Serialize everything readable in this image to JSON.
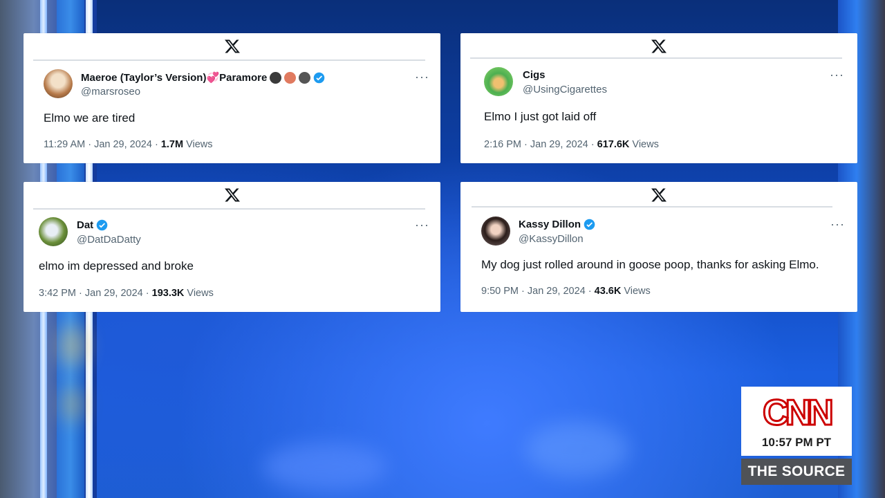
{
  "tweets": [
    {
      "display_name": "Maeroe (Taylor’s Version)💞Paramore",
      "handle": "@marsroseo",
      "text": "Elmo we are tired",
      "time": "11:29 AM · Jan 29, 2024 · ",
      "views_count": "1.7M",
      "views_label": " Views",
      "verified": true
    },
    {
      "display_name": "Cigs",
      "handle": "@UsingCigarettes",
      "text": "Elmo I just got laid off",
      "time": "2:16 PM · Jan 29, 2024 · ",
      "views_count": "617.6K",
      "views_label": " Views",
      "verified": false
    },
    {
      "display_name": "Dat",
      "handle": "@DatDaDatty",
      "text": "elmo im depressed and broke",
      "time": "3:42 PM · Jan 29, 2024 · ",
      "views_count": "193.3K",
      "views_label": " Views",
      "verified": true
    },
    {
      "display_name": "Kassy Dillon",
      "handle": "@KassyDillon",
      "text": "My dog just rolled around in goose poop, thanks for asking Elmo.",
      "time": "9:50 PM · Jan 29, 2024 · ",
      "views_count": "43.6K",
      "views_label": " Views",
      "verified": true
    }
  ],
  "more_label": "···",
  "x_logo": "X",
  "cnn": {
    "logo": "CNN",
    "time": "10:57 PM PT",
    "show": "THE SOURCE"
  },
  "colors": {
    "verified": "#1d9bf0",
    "cnn_red": "#cc0000",
    "background": "#1450c8"
  }
}
